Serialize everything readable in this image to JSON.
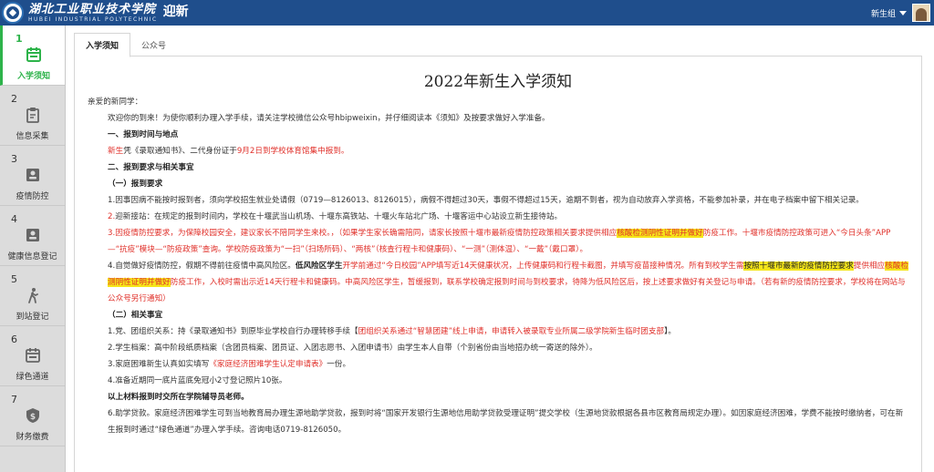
{
  "header": {
    "logo_cn": "湖北工业职业技术学院",
    "logo_en": "HUBEI INDUSTRIAL POLYTECHNIC",
    "app_title": "迎新",
    "user_name": "新生组"
  },
  "sidebar": {
    "items": [
      {
        "num": "1",
        "label": "入学须知",
        "icon": "calendar-icon",
        "active": true
      },
      {
        "num": "2",
        "label": "信息采集",
        "icon": "clipboard-icon"
      },
      {
        "num": "3",
        "label": "疫情防控",
        "icon": "id-card-icon"
      },
      {
        "num": "4",
        "label": "健康信息登记",
        "icon": "id-card-icon"
      },
      {
        "num": "5",
        "label": "到站登记",
        "icon": "walking-person-icon"
      },
      {
        "num": "6",
        "label": "绿色通道",
        "icon": "calendar-icon"
      },
      {
        "num": "7",
        "label": "财务缴费",
        "icon": "money-shield-icon"
      }
    ]
  },
  "tabs": [
    {
      "label": "入学须知",
      "active": true
    },
    {
      "label": "公众号"
    }
  ],
  "doc": {
    "title": "2022年新生入学须知",
    "greeting": "亲爱的新同学：",
    "intro": "欢迎你的到来！为使你顺利办理入学手续，请关注学校微信公众号hbipweixin，并仔细阅读本《须知》及按要求做好入学准备。",
    "s1_title": "一、报到时间与地点",
    "s1_line_a": "新生",
    "s1_line_b": "凭《录取通知书》、二代身份证于",
    "s1_line_c": "9月2日",
    "s1_line_d": "到学校体育馆集中报到。",
    "s2_title": "二、报到要求与相关事宜",
    "s2a_title": "（一）报到要求",
    "p1": "1.因事因病不能按时报到者，须向学校招生就业处请假（0719—8126013、8126015），病假不得超过30天，事假不得超过15天，逾期不到者，视为自动放弃入学资格，不能参加补录，并在电子档案中留下相关记录。",
    "p2_num": "2.",
    "p2": "迎新接站：在规定的报到时间内，学校在十堰武当山机场、十堰东高铁站、十堰火车站北广场、十堰客运中心站设立新生接待站。",
    "p3_a": "3.因疫情防控要求，为保障校园安全，建议家长不陪同学生来校。，（如果学生家长确需陪同，请家长按照十堰市最新疫情防控政策相关要求提供相应",
    "p3_hl": "核酸检测阴性证明并做好",
    "p3_b": "防疫工作。十堰市疫情防控政策可进入“今日头条”APP—“抗疫”模块—“防疫政策”查询。学校防疫政策为“一扫”（扫场所码）、“两核”（核查行程卡和健康码）、“一测”（测体温）、“一戴”（戴口罩）。",
    "p4_a": "4.自觉做好疫情防控，假期不得前往疫情中高风险区。",
    "p4_b": "低风险区学生",
    "p4_c": "开学前通过“今日校园”APP填写近14天健康状况，上传健康码和行程卡截图，并填写疫苗接种情况。所有到校学生需",
    "p4_hl1": "按照十堰市最新的疫情防控要求",
    "p4_d": "提供相应",
    "p4_hl2": "核酸检测阴性证明并做好",
    "p4_e": "防疫工作，入校时需出示近14天行程卡和健康码。中高风险区学生，暂缓报到，联系学校确定报到时间与到校要求，待降为低风险区后，按上述要求做好有关登记与申请。（若有新的疫情防控要求，学校将在网站与公众号另行通知）",
    "s2b_title": "（二）相关事宜",
    "r1_a": "1.党、团组织关系：持《录取通知书》到原毕业学校自行办理转移手续【",
    "r1_b": "团组织关系通过“智慧团建”线上申请，申请转入被录取专业所属二级学院新生临时团支部",
    "r1_c": "】。",
    "r2": "2.学生档案：高中阶段纸质档案（含团员档案、团员证、入团志愿书、入团申请书）由学生本人自带（个别省份由当地招办统一寄送的除外）。",
    "r3_a": "3.家庭困难新生认真如实填写",
    "r3_b": "《家庭经济困难学生认定申请表》",
    "r3_c": "一份。",
    "r4": "4.准备近期同一底片蓝底免冠小2寸登记照片10张。",
    "r5": "以上材料报到时交所在学院辅导员老师。",
    "r6": "6.助学贷款。家庭经济困难学生可到当地教育局办理生源地助学贷款，报到时将“国家开发银行生源地信用助学贷款受理证明”提交学校（生源地贷款根据各县市区教育局规定办理）。如因家庭经济困难，学费不能按时缴纳者，可在新生报到时通过“绿色通道”办理入学手续。咨询电话0719-8126050。"
  }
}
